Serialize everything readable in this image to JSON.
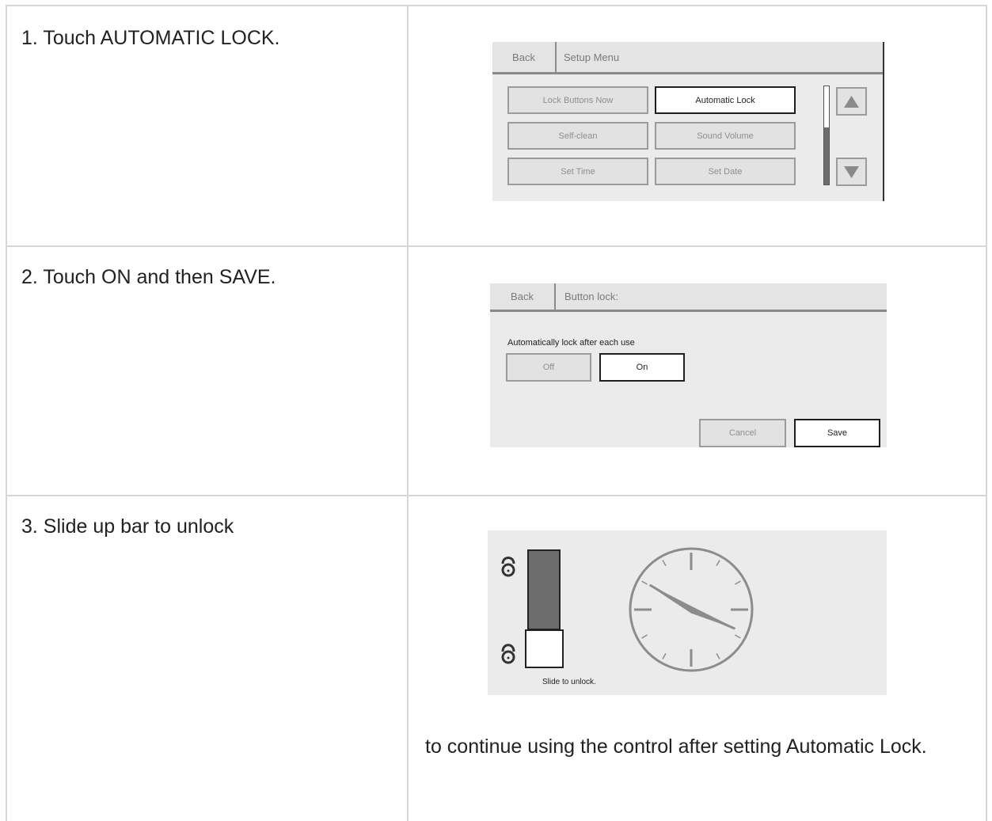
{
  "steps": [
    {
      "text": "1. Touch AUTOMATIC LOCK."
    },
    {
      "text": "2. Touch ON and then SAVE."
    },
    {
      "text": "3. Slide up bar to unlock"
    }
  ],
  "note": "to continue using the control after setting Automatic Lock.",
  "screen1": {
    "back": "Back",
    "title": "Setup Menu",
    "buttons": [
      "Lock Buttons Now",
      "Automatic Lock",
      "Self-clean",
      "Sound Volume",
      "Set Time",
      "Set Date"
    ],
    "selected": "Automatic Lock"
  },
  "screen2": {
    "back": "Back",
    "title": "Button lock:",
    "label": "Automatically lock after each use",
    "off": "Off",
    "on": "On",
    "cancel": "Cancel",
    "save": "Save"
  },
  "screen3": {
    "caption": "Slide to unlock.",
    "icons": [
      "lock-open-icon",
      "lock-closed-icon",
      "clock-icon"
    ]
  },
  "colors": {
    "panel": "#ebebeb",
    "border": "#d6d6d6",
    "selected_border": "#1f1f1f",
    "inactive_text": "#8e8e8e",
    "slider_fill": "#6d6d6d"
  }
}
